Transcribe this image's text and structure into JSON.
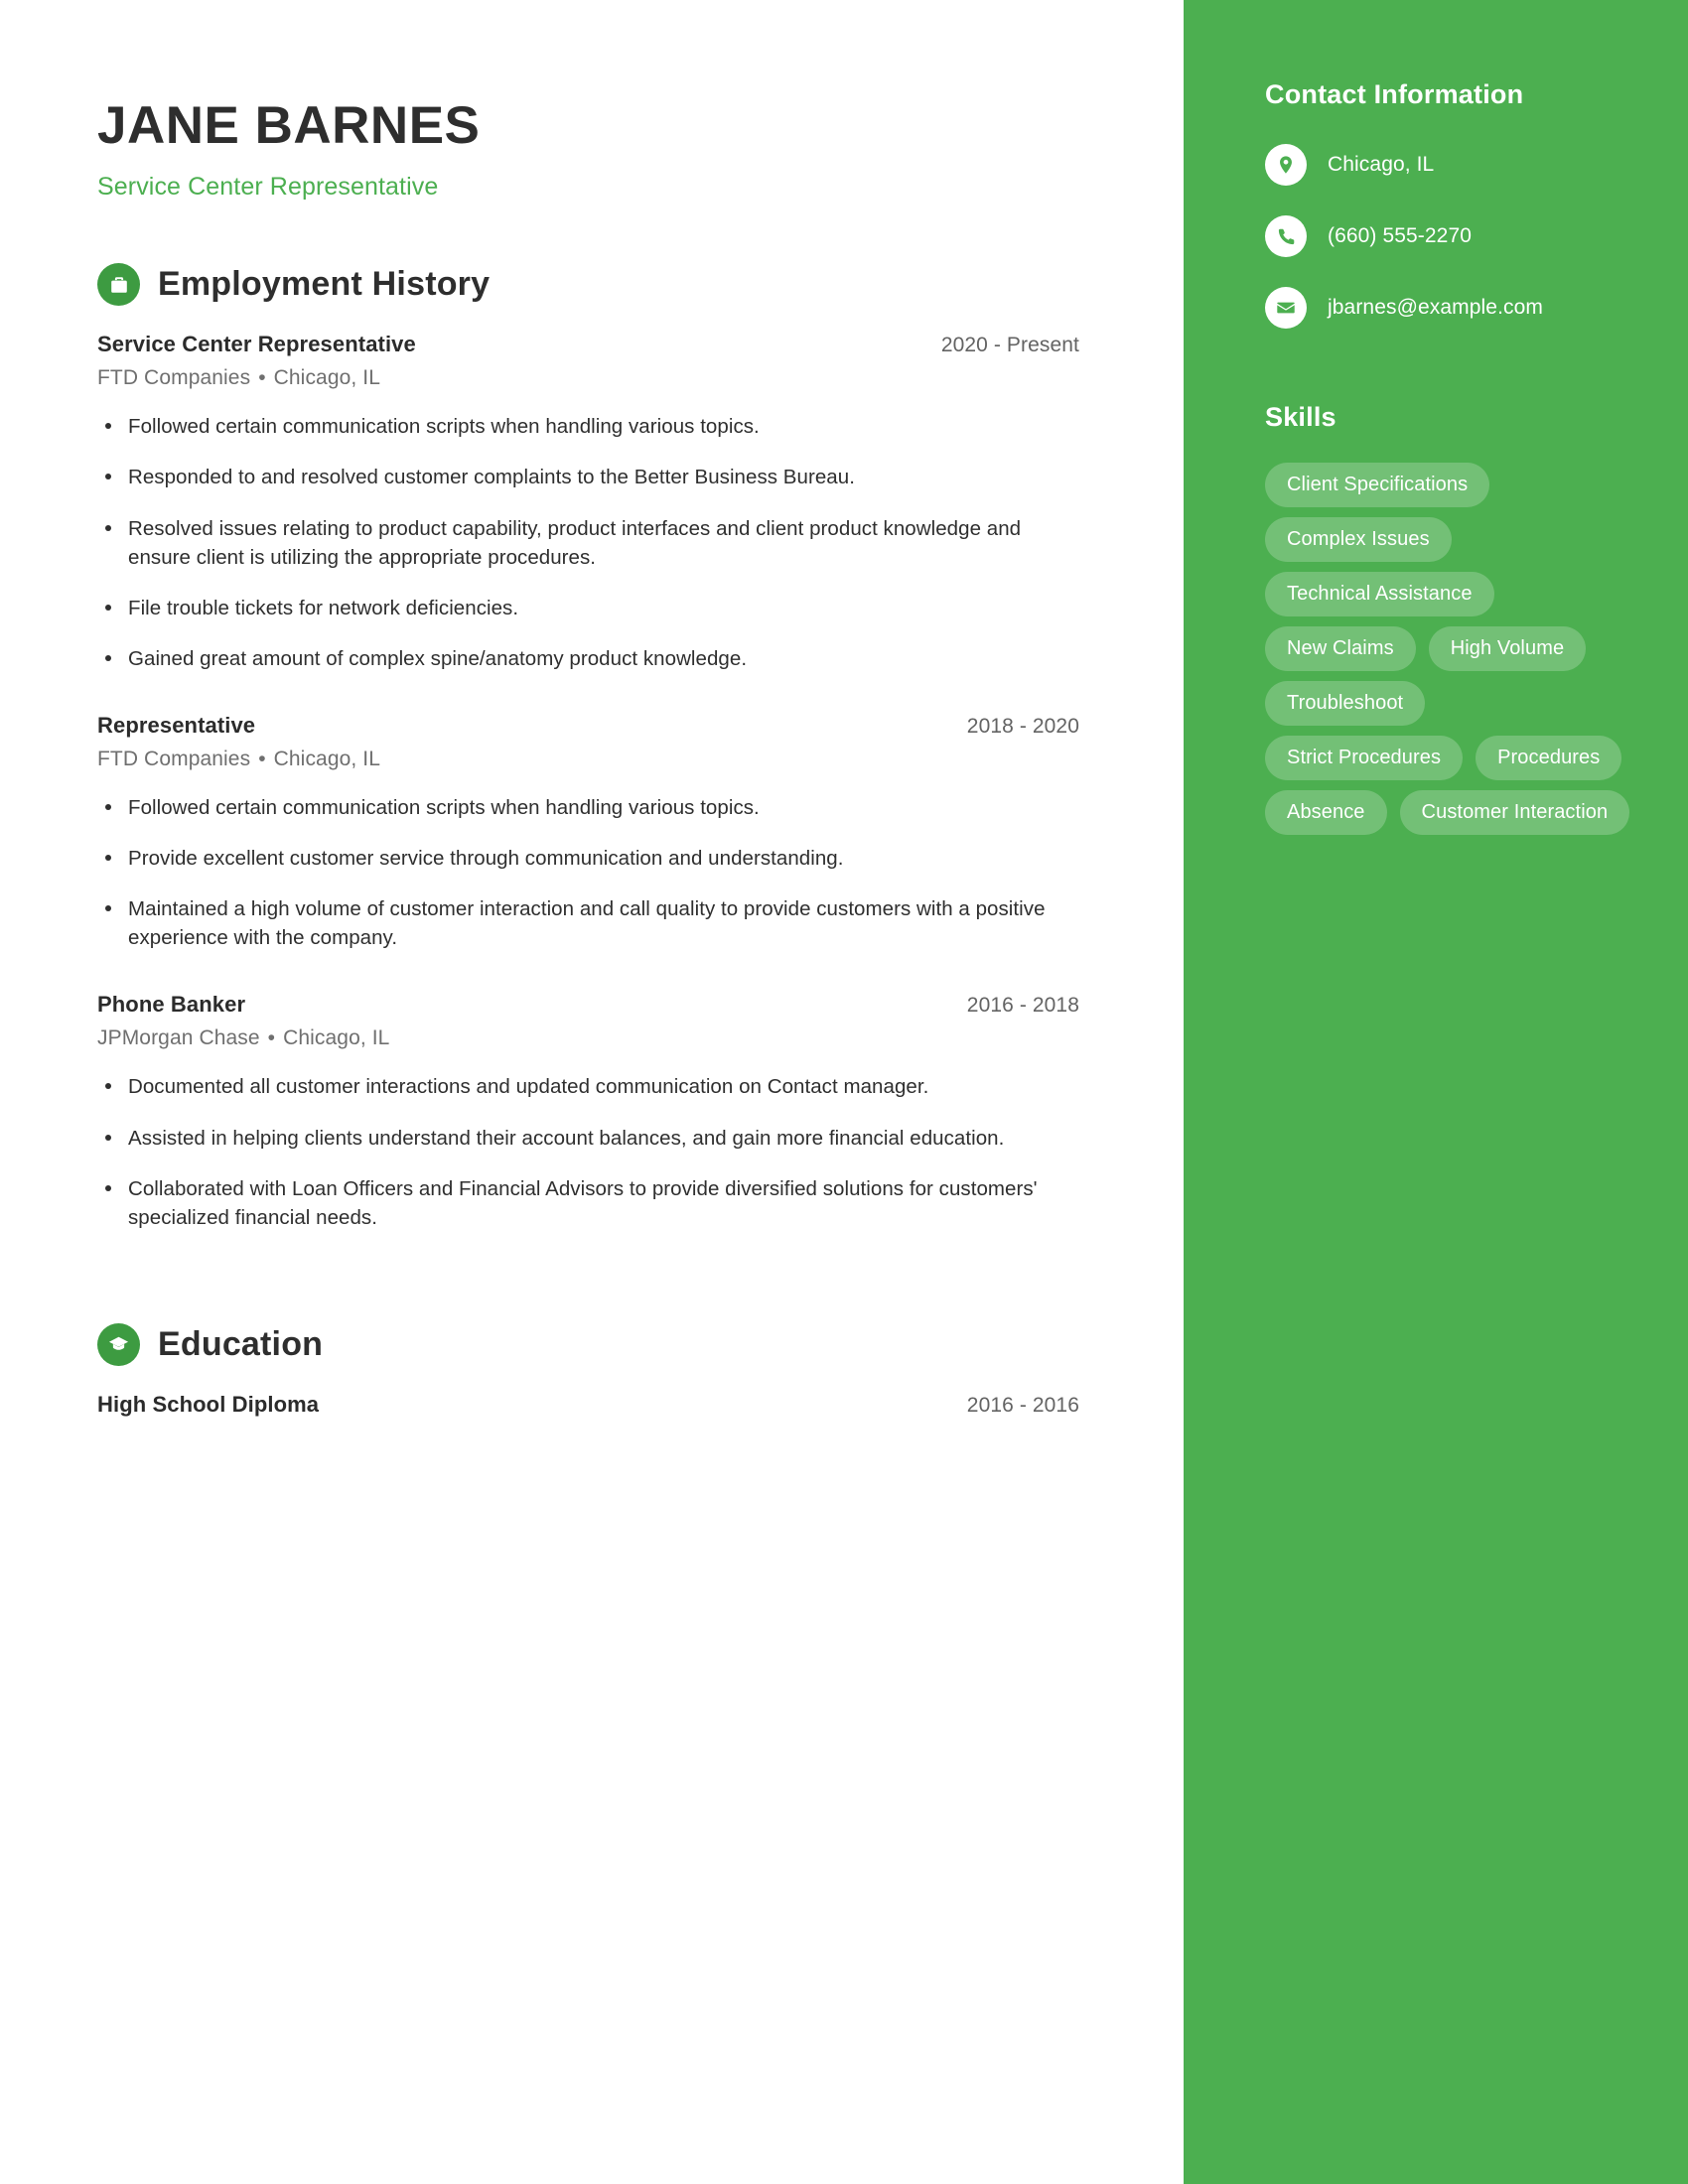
{
  "header": {
    "name": "JANE BARNES",
    "subtitle": "Service Center Representative"
  },
  "employment": {
    "section_title": "Employment History",
    "icon": "briefcase-icon",
    "entries": [
      {
        "title": "Service Center Representative",
        "date": "2020 - Present",
        "company": "FTD Companies",
        "separator": "•",
        "location": "Chicago, IL",
        "bullets": [
          "Followed certain communication scripts when handling various topics.",
          "Responded to and resolved customer complaints to the Better Business Bureau.",
          "Resolved issues relating to product capability, product interfaces and client product knowledge and ensure client is utilizing the appropriate procedures.",
          "File trouble tickets for network deficiencies.",
          "Gained great amount of complex spine/anatomy product knowledge."
        ]
      },
      {
        "title": "Representative",
        "date": "2018 - 2020",
        "company": "FTD Companies",
        "separator": "•",
        "location": "Chicago, IL",
        "bullets": [
          "Followed certain communication scripts when handling various topics.",
          "Provide excellent customer service through communication and understanding.",
          "Maintained a high volume of customer interaction and call quality to provide customers with a positive experience with the company."
        ]
      },
      {
        "title": "Phone Banker",
        "date": "2016 - 2018",
        "company": "JPMorgan Chase",
        "separator": "•",
        "location": "Chicago, IL",
        "bullets": [
          "Documented all customer interactions and updated communication on Contact manager.",
          "Assisted in helping clients understand their account balances, and gain more financial education.",
          "Collaborated with Loan Officers and Financial Advisors to provide diversified solutions for customers' specialized financial needs."
        ]
      }
    ]
  },
  "education": {
    "section_title": "Education",
    "icon": "graduation-cap-icon",
    "entries": [
      {
        "title": "High School Diploma",
        "date": "2016 - 2016"
      }
    ]
  },
  "sidebar": {
    "contact": {
      "title": "Contact Information",
      "items": [
        {
          "icon": "location-pin-icon",
          "value": "Chicago, IL"
        },
        {
          "icon": "phone-icon",
          "value": "(660) 555-2270"
        },
        {
          "icon": "envelope-icon",
          "value": "jbarnes@example.com"
        }
      ]
    },
    "skills": {
      "title": "Skills",
      "items": [
        "Client Specifications",
        "Complex Issues",
        "Technical Assistance",
        "New Claims",
        "High Volume",
        "Troubleshoot",
        "Strict Procedures",
        "Procedures",
        "Absence",
        "Customer Interaction"
      ]
    }
  },
  "colors": {
    "accent_green": "#4CAF50",
    "icon_green": "#3d9b41",
    "heading_dark": "#2e2e2e",
    "body_text": "#2f2f2f",
    "muted_text": "#6f6f6f",
    "pill_bg": "rgba(255,255,255,0.22)"
  }
}
